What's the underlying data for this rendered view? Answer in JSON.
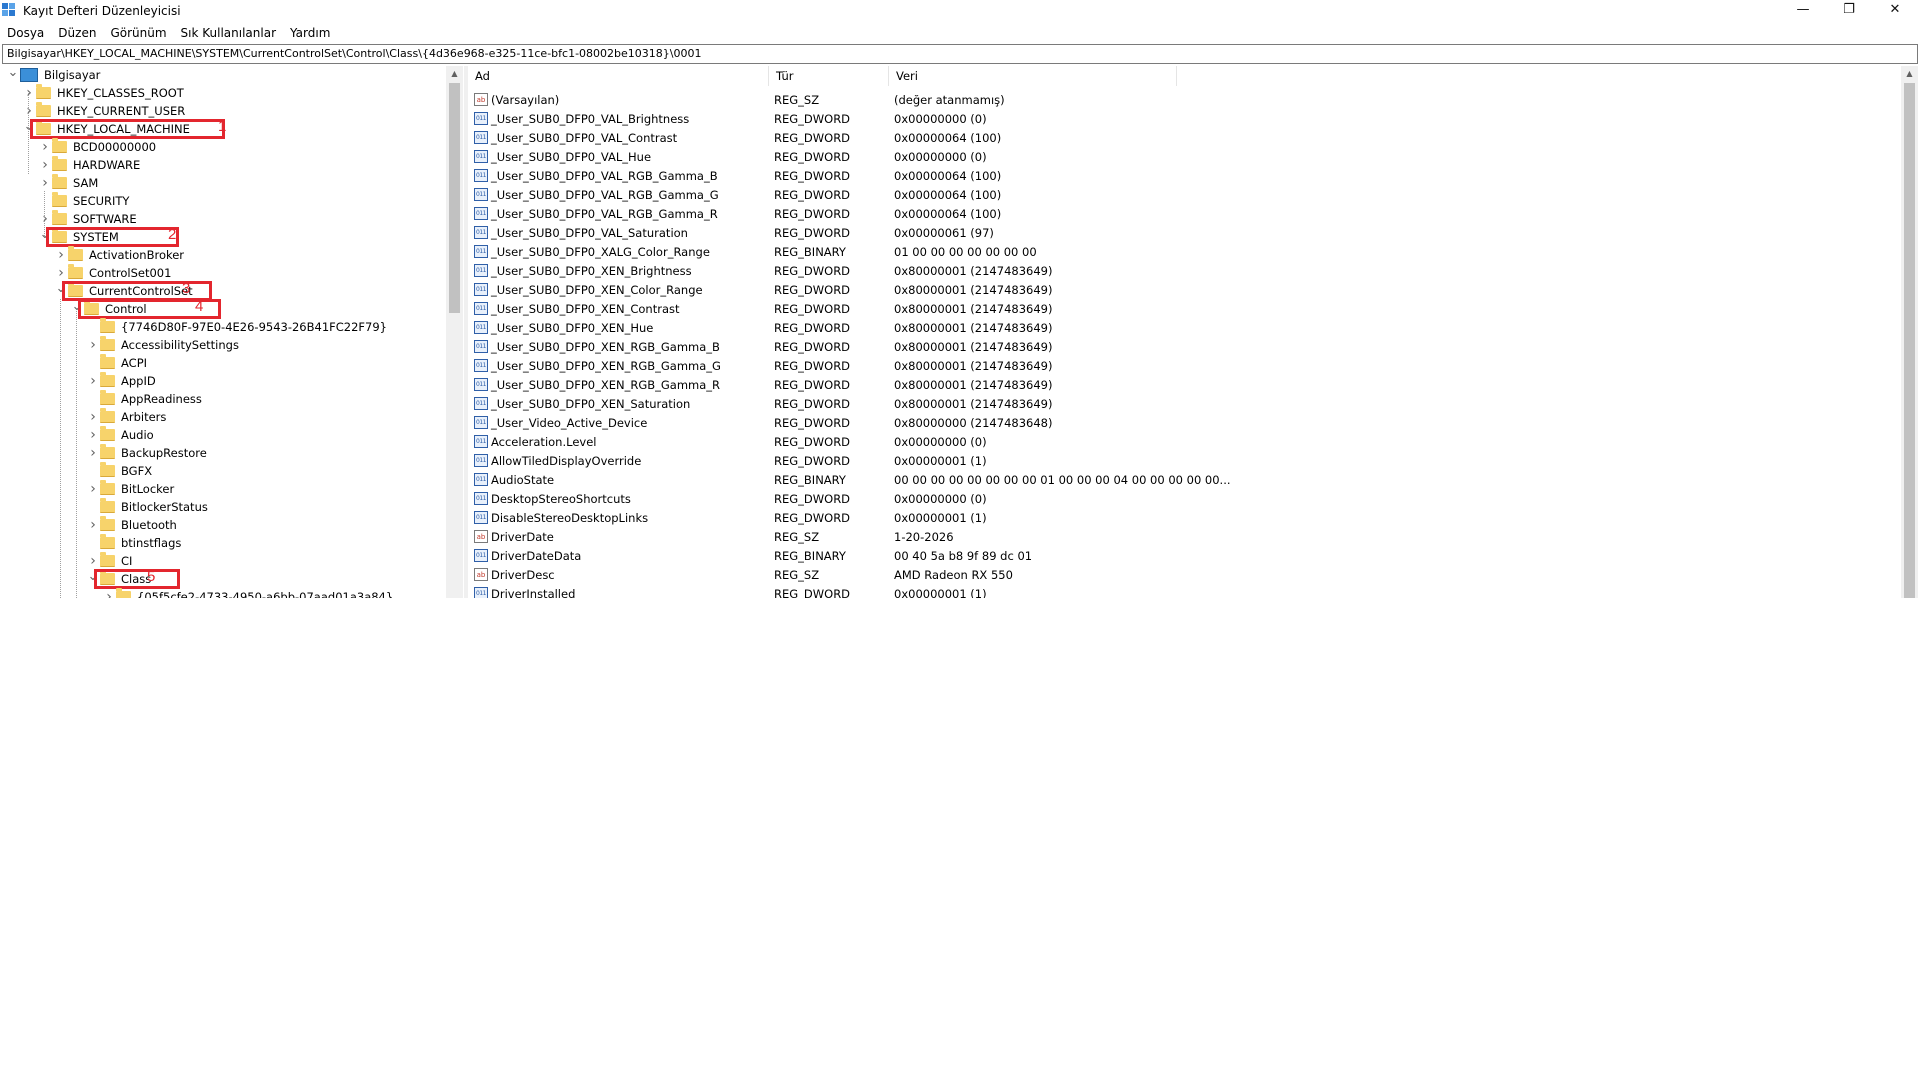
{
  "window": {
    "title": "Kayıt Defteri Düzenleyicisi",
    "minimize_icon": "—",
    "maximize_icon": "❐",
    "close_icon": "✕"
  },
  "menu": [
    "Dosya",
    "Düzen",
    "Görünüm",
    "Sık Kullanılanlar",
    "Yardım"
  ],
  "address": "Bilgisayar\\HKEY_LOCAL_MACHINE\\SYSTEM\\CurrentControlSet\\Control\\Class\\{4d36e968-e325-11ce-bfc1-08002be10318}\\0001",
  "tree": [
    {
      "label": "Bilgisayar",
      "level": 0,
      "state": "expanded",
      "icon": "computer-icon"
    },
    {
      "label": "HKEY_CLASSES_ROOT",
      "level": 1,
      "state": "collapsed"
    },
    {
      "label": "HKEY_CURRENT_USER",
      "level": 1,
      "state": "collapsed"
    },
    {
      "label": "HKEY_LOCAL_MACHINE",
      "level": 1,
      "state": "expanded",
      "annotation": "1"
    },
    {
      "label": "BCD00000000",
      "level": 2,
      "state": "collapsed"
    },
    {
      "label": "HARDWARE",
      "level": 2,
      "state": "collapsed"
    },
    {
      "label": "SAM",
      "level": 2,
      "state": "collapsed"
    },
    {
      "label": "SECURITY",
      "level": 2,
      "state": "none"
    },
    {
      "label": "SOFTWARE",
      "level": 2,
      "state": "collapsed"
    },
    {
      "label": "SYSTEM",
      "level": 2,
      "state": "expanded",
      "annotation": "2"
    },
    {
      "label": "ActivationBroker",
      "level": 3,
      "state": "collapsed"
    },
    {
      "label": "ControlSet001",
      "level": 3,
      "state": "collapsed"
    },
    {
      "label": "CurrentControlSet",
      "level": 3,
      "state": "expanded",
      "annotation": "3"
    },
    {
      "label": "Control",
      "level": 4,
      "state": "expanded",
      "annotation": "4"
    },
    {
      "label": "{7746D80F-97E0-4E26-9543-26B41FC22F79}",
      "level": 5,
      "state": "none"
    },
    {
      "label": "AccessibilitySettings",
      "level": 5,
      "state": "collapsed"
    },
    {
      "label": "ACPI",
      "level": 5,
      "state": "none"
    },
    {
      "label": "AppID",
      "level": 5,
      "state": "collapsed"
    },
    {
      "label": "AppReadiness",
      "level": 5,
      "state": "none"
    },
    {
      "label": "Arbiters",
      "level": 5,
      "state": "collapsed"
    },
    {
      "label": "Audio",
      "level": 5,
      "state": "collapsed"
    },
    {
      "label": "BackupRestore",
      "level": 5,
      "state": "collapsed"
    },
    {
      "label": "BGFX",
      "level": 5,
      "state": "none"
    },
    {
      "label": "BitLocker",
      "level": 5,
      "state": "collapsed"
    },
    {
      "label": "BitlockerStatus",
      "level": 5,
      "state": "none"
    },
    {
      "label": "Bluetooth",
      "level": 5,
      "state": "collapsed"
    },
    {
      "label": "btinstflags",
      "level": 5,
      "state": "none"
    },
    {
      "label": "CI",
      "level": 5,
      "state": "collapsed"
    },
    {
      "label": "Class",
      "level": 5,
      "state": "expanded",
      "annotation": "5"
    },
    {
      "label": "{05f5cfe2-4733-4950-a6bb-07aad01a3a84}",
      "level": 6,
      "state": "collapsed"
    }
  ],
  "columns": {
    "name": "Ad",
    "type": "Tür",
    "data": "Veri"
  },
  "values": [
    {
      "icon": "string",
      "name": "(Varsayılan)",
      "type": "REG_SZ",
      "data": "(değer atanmamış)"
    },
    {
      "icon": "binary",
      "name": "_User_SUB0_DFP0_VAL_Brightness",
      "type": "REG_DWORD",
      "data": "0x00000000 (0)"
    },
    {
      "icon": "binary",
      "name": "_User_SUB0_DFP0_VAL_Contrast",
      "type": "REG_DWORD",
      "data": "0x00000064 (100)"
    },
    {
      "icon": "binary",
      "name": "_User_SUB0_DFP0_VAL_Hue",
      "type": "REG_DWORD",
      "data": "0x00000000 (0)"
    },
    {
      "icon": "binary",
      "name": "_User_SUB0_DFP0_VAL_RGB_Gamma_B",
      "type": "REG_DWORD",
      "data": "0x00000064 (100)"
    },
    {
      "icon": "binary",
      "name": "_User_SUB0_DFP0_VAL_RGB_Gamma_G",
      "type": "REG_DWORD",
      "data": "0x00000064 (100)"
    },
    {
      "icon": "binary",
      "name": "_User_SUB0_DFP0_VAL_RGB_Gamma_R",
      "type": "REG_DWORD",
      "data": "0x00000064 (100)"
    },
    {
      "icon": "binary",
      "name": "_User_SUB0_DFP0_VAL_Saturation",
      "type": "REG_DWORD",
      "data": "0x00000061 (97)"
    },
    {
      "icon": "binary",
      "name": "_User_SUB0_DFP0_XALG_Color_Range",
      "type": "REG_BINARY",
      "data": "01 00 00 00 00 00 00 00"
    },
    {
      "icon": "binary",
      "name": "_User_SUB0_DFP0_XEN_Brightness",
      "type": "REG_DWORD",
      "data": "0x80000001 (2147483649)"
    },
    {
      "icon": "binary",
      "name": "_User_SUB0_DFP0_XEN_Color_Range",
      "type": "REG_DWORD",
      "data": "0x80000001 (2147483649)"
    },
    {
      "icon": "binary",
      "name": "_User_SUB0_DFP0_XEN_Contrast",
      "type": "REG_DWORD",
      "data": "0x80000001 (2147483649)"
    },
    {
      "icon": "binary",
      "name": "_User_SUB0_DFP0_XEN_Hue",
      "type": "REG_DWORD",
      "data": "0x80000001 (2147483649)"
    },
    {
      "icon": "binary",
      "name": "_User_SUB0_DFP0_XEN_RGB_Gamma_B",
      "type": "REG_DWORD",
      "data": "0x80000001 (2147483649)"
    },
    {
      "icon": "binary",
      "name": "_User_SUB0_DFP0_XEN_RGB_Gamma_G",
      "type": "REG_DWORD",
      "data": "0x80000001 (2147483649)"
    },
    {
      "icon": "binary",
      "name": "_User_SUB0_DFP0_XEN_RGB_Gamma_R",
      "type": "REG_DWORD",
      "data": "0x80000001 (2147483649)"
    },
    {
      "icon": "binary",
      "name": "_User_SUB0_DFP0_XEN_Saturation",
      "type": "REG_DWORD",
      "data": "0x80000001 (2147483649)"
    },
    {
      "icon": "binary",
      "name": "_User_Video_Active_Device",
      "type": "REG_DWORD",
      "data": "0x80000000 (2147483648)"
    },
    {
      "icon": "binary",
      "name": "Acceleration.Level",
      "type": "REG_DWORD",
      "data": "0x00000000 (0)"
    },
    {
      "icon": "binary",
      "name": "AllowTiledDisplayOverride",
      "type": "REG_DWORD",
      "data": "0x00000001 (1)"
    },
    {
      "icon": "binary",
      "name": "AudioState",
      "type": "REG_BINARY",
      "data": "00 00 00 00 00 00 00 00 01 00 00 00 04 00 00 00 00 00..."
    },
    {
      "icon": "binary",
      "name": "DesktopStereoShortcuts",
      "type": "REG_DWORD",
      "data": "0x00000000 (0)"
    },
    {
      "icon": "binary",
      "name": "DisableStereoDesktopLinks",
      "type": "REG_DWORD",
      "data": "0x00000001 (1)"
    },
    {
      "icon": "string",
      "name": "DriverDate",
      "type": "REG_SZ",
      "data": "1-20-2026"
    },
    {
      "icon": "binary",
      "name": "DriverDateData",
      "type": "REG_BINARY",
      "data": "00 40 5a b8 9f 89 dc 01"
    },
    {
      "icon": "string",
      "name": "DriverDesc",
      "type": "REG_SZ",
      "data": "AMD Radeon RX 550"
    },
    {
      "icon": "binary",
      "name": "DriverInstalled",
      "type": "REG_DWORD",
      "data": "0x00000001 (1)"
    }
  ],
  "colors": {
    "annotation": "#e3262e",
    "folder": "#f7d36b"
  }
}
